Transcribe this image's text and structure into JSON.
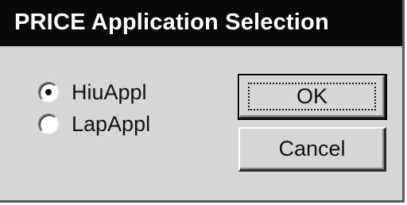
{
  "window": {
    "title": "PRICE Application Selection"
  },
  "options": {
    "selected": "HiuAppl",
    "items": [
      {
        "label": "HiuAppl",
        "checked": true
      },
      {
        "label": "LapAppl",
        "checked": false
      }
    ]
  },
  "buttons": {
    "ok_label": "OK",
    "cancel_label": "Cancel"
  },
  "colors": {
    "titlebar": "#0a0a0a",
    "title_text": "#ffffff",
    "dialog_face": "#d6d6d6"
  }
}
